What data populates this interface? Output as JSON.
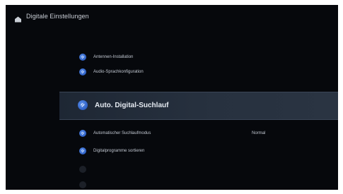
{
  "header": {
    "icon": "home-icon",
    "title": "Digitale Einstellungen"
  },
  "menu": {
    "items": [
      {
        "label": "Antennen-Installation",
        "icon": "satellite-icon",
        "value": "",
        "state": "normal"
      },
      {
        "label": "Audio-Sprachkonfiguration",
        "icon": "settings-icon",
        "value": "",
        "state": "normal"
      },
      {
        "label": "Auto. Digital-Suchlauf",
        "icon": "search-icon",
        "value": "",
        "state": "selected"
      },
      {
        "label": "Automatischer Suchlaufmodus",
        "icon": "scan-icon",
        "value": "Normal",
        "state": "normal"
      },
      {
        "label": "Digitalprogramme sortieren",
        "icon": "list-icon",
        "value": "",
        "state": "normal"
      },
      {
        "label": "",
        "icon": "disabled-icon",
        "value": "",
        "state": "disabled"
      },
      {
        "label": "",
        "icon": "disabled-icon",
        "value": "",
        "state": "disabled"
      }
    ]
  },
  "colors": {
    "background": "#06080c",
    "highlight": "#27313f",
    "icon_blue": "#2d5fc4",
    "text": "#c2c8d2"
  }
}
